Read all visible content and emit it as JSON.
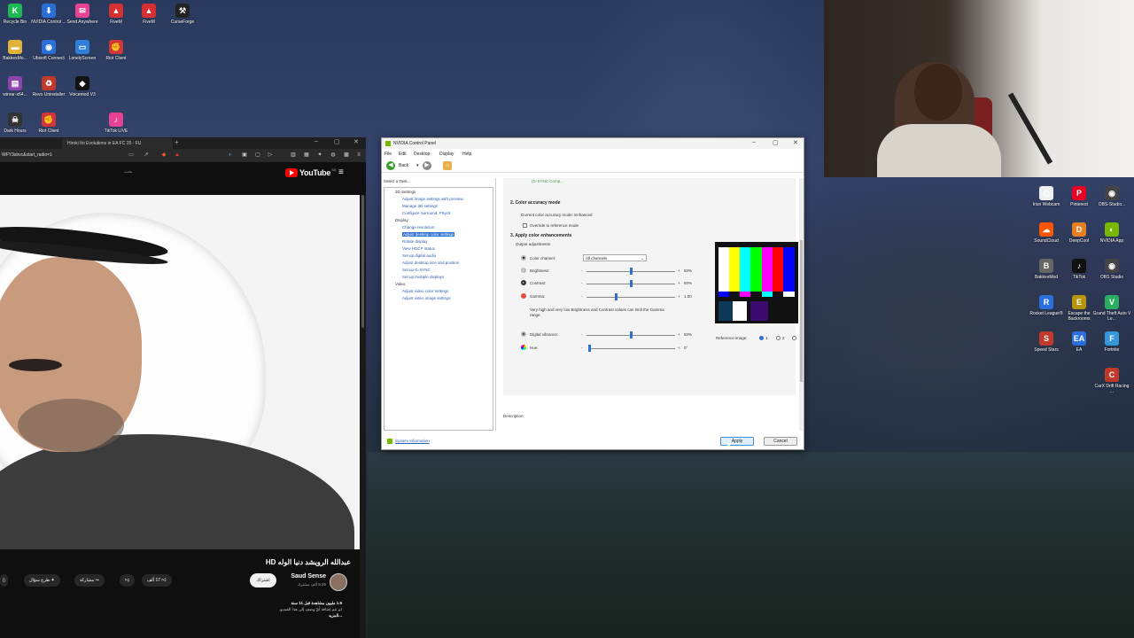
{
  "desktop_left": [
    {
      "label": "Recycle Bin",
      "icon": "recycle-bin-icon",
      "glyph": "K",
      "color": "#1db954"
    },
    {
      "label": "NVIDIA Control ...",
      "icon": "nvidia-icon",
      "glyph": "⬇",
      "color": "#2b6fd6"
    },
    {
      "label": "Send Anywhere",
      "icon": "send-anywhere-icon",
      "glyph": "✉",
      "color": "#e84393"
    },
    {
      "label": "FiveM",
      "icon": "fivem-icon",
      "glyph": "▲",
      "color": "#d63031"
    },
    {
      "label": "FiveM",
      "icon": "fivem-icon",
      "glyph": "▲",
      "color": "#d63031"
    },
    {
      "label": "CurseForge",
      "icon": "curseforge-icon",
      "glyph": "⚒",
      "color": "#222222"
    },
    {
      "label": "BakkesMo...",
      "icon": "folder-icon",
      "glyph": "▬",
      "color": "#e0b23a"
    },
    {
      "label": "Ubisoft Connect",
      "icon": "ubisoft-icon",
      "glyph": "◉",
      "color": "#2a6fdb"
    },
    {
      "label": "LonelyScreen",
      "icon": "lonelyscreen-icon",
      "glyph": "▭",
      "color": "#2f7fd6"
    },
    {
      "label": "Riot Client",
      "icon": "riot-client-icon",
      "glyph": "✊",
      "color": "#d13639"
    },
    {
      "label": "winrar-x64...",
      "icon": "winrar-icon",
      "glyph": "▤",
      "color": "#8e44ad"
    },
    {
      "label": "Revo Uninstaller",
      "icon": "revo-icon",
      "glyph": "♻",
      "color": "#c0392b"
    },
    {
      "label": "Voicemod V3",
      "icon": "voicemod-icon",
      "glyph": "◆",
      "color": "#111111"
    },
    {
      "label": "Dark Hours",
      "icon": "dark-hours-icon",
      "glyph": "☠",
      "color": "#333333"
    },
    {
      "label": "Riot Client",
      "icon": "riot-client-icon",
      "glyph": "✊",
      "color": "#d13639"
    },
    {
      "label": "TikTok LIVE",
      "icon": "tiktok-live-icon",
      "glyph": "♪",
      "color": "#e84393"
    }
  ],
  "desktop_right": [
    {
      "label": "Iriun Webcam",
      "icon": "iriun-webcam-icon",
      "glyph": "◎",
      "color": "#ecf0f1"
    },
    {
      "label": "Pinterest",
      "icon": "pinterest-icon",
      "glyph": "P",
      "color": "#e60023"
    },
    {
      "label": "OBS-Studio...",
      "icon": "obs-icon",
      "glyph": "◉",
      "color": "#444444"
    },
    {
      "label": "SoundCloud",
      "icon": "soundcloud-icon",
      "glyph": "☁",
      "color": "#ff5500"
    },
    {
      "label": "DeepCool",
      "icon": "deepcool-icon",
      "glyph": "D",
      "color": "#e67e22"
    },
    {
      "label": "NVIDIA App",
      "icon": "nvidia-app-icon",
      "glyph": "◐",
      "color": "#76b900"
    },
    {
      "label": "BakkesMod",
      "icon": "bakkesmod-icon",
      "glyph": "B",
      "color": "#666666"
    },
    {
      "label": "TikTok",
      "icon": "tiktok-icon",
      "glyph": "♪",
      "color": "#111111"
    },
    {
      "label": "OBS Studio",
      "icon": "obs-icon",
      "glyph": "◉",
      "color": "#444444"
    },
    {
      "label": "Rocket League®",
      "icon": "rocket-league-icon",
      "glyph": "R",
      "color": "#2a6fdb"
    },
    {
      "label": "Escape the Backrooms",
      "icon": "escape-backrooms-icon",
      "glyph": "E",
      "color": "#b7950b"
    },
    {
      "label": "Grand Theft Auto V Le...",
      "icon": "gta-icon",
      "glyph": "V",
      "color": "#27ae60"
    },
    {
      "label": "Speed Stars",
      "icon": "speed-stars-icon",
      "glyph": "S",
      "color": "#c0392b"
    },
    {
      "label": "EA",
      "icon": "ea-icon",
      "glyph": "EA",
      "color": "#2a6fdb"
    },
    {
      "label": "Fortnite",
      "icon": "fortnite-icon",
      "glyph": "F",
      "color": "#3498db"
    },
    {
      "label": "CarX Drift Racing ...",
      "icon": "carx-icon",
      "glyph": "C",
      "color": "#c0392b"
    }
  ],
  "browser": {
    "tab_title": "Hiroki Ito Evolutions in EA FC 25 - FU",
    "url": "WFY3sbvc&start_radio=1",
    "search_placeholder": "بحث",
    "youtube_logo": "YouTube",
    "youtube_region": "SA",
    "video": {
      "title": "عبدالله الرويشد دنيا الوله HD",
      "channel": "Saud Sense",
      "subscribers": "9.25 ألف مشترك",
      "subscribe_label": "اشتراك",
      "likes": "17 ألف",
      "share_label": "مشاركة",
      "ask_label": "طرح سؤال",
      "views": "1.9 مليون مشاهدة قبل 11 سنة",
      "description": "لم تتم إضافة أيّ وصف إلى هذا الفيديو.",
      "more_label": "...المزيد"
    }
  },
  "nvidia": {
    "title": "NVIDIA Control Panel",
    "menu": [
      "File",
      "Edit",
      "Desktop",
      "Display",
      "Help"
    ],
    "back_label": "Back",
    "select_task": "Select a Task...",
    "tree": {
      "cat_3d": "3D Settings",
      "items_3d": [
        "Adjust image settings with preview",
        "Manage 3D settings",
        "Configure Surround, PhysX"
      ],
      "cat_display": "Display",
      "items_display": [
        "Change resolution",
        "Adjust desktop color settings",
        "Rotate display",
        "View HDCP status",
        "Set up digital audio",
        "Adjust desktop size and position",
        "Set up G-SYNC",
        "Set up multiple displays"
      ],
      "cat_video": "Video",
      "items_video": [
        "Adjust video color settings",
        "Adjust video image settings"
      ]
    },
    "gsync_note": "(G-SYNC Comp...",
    "section2_title": "2. Color accuracy mode",
    "current_mode": "Current color accuracy mode: Enhanced",
    "override_label": "Override to reference mode",
    "section3_title": "3. Apply color enhancements",
    "output_adjustments": "Output adjustments",
    "color_channel_label": "Color channel:",
    "color_channel_value": "All channels",
    "sliders": [
      {
        "label": "Brightness:",
        "value": "50%",
        "level": 0.5,
        "icon": "brightness-icon"
      },
      {
        "label": "Contrast:",
        "value": "50%",
        "level": 0.5,
        "icon": "contrast-icon"
      },
      {
        "label": "Gamma:",
        "value": "1.00",
        "level": 0.33,
        "icon": "gamma-icon"
      }
    ],
    "warning": "Very high and very low Brightness and Contrast values can limit the Gamma range.",
    "vibrance_label": "Digital vibrance:",
    "vibrance_value": "50%",
    "vibrance_level": 0.5,
    "hue_label": "Hue:",
    "hue_value": "0°",
    "hue_level": 0.0,
    "reference_label": "Reference image:",
    "reference_options": [
      "1",
      "2",
      "3"
    ],
    "minus": "-",
    "plus": "+",
    "description_label": "Description:",
    "system_info": "System Information",
    "apply_label": "Apply",
    "cancel_label": "Cancel"
  }
}
